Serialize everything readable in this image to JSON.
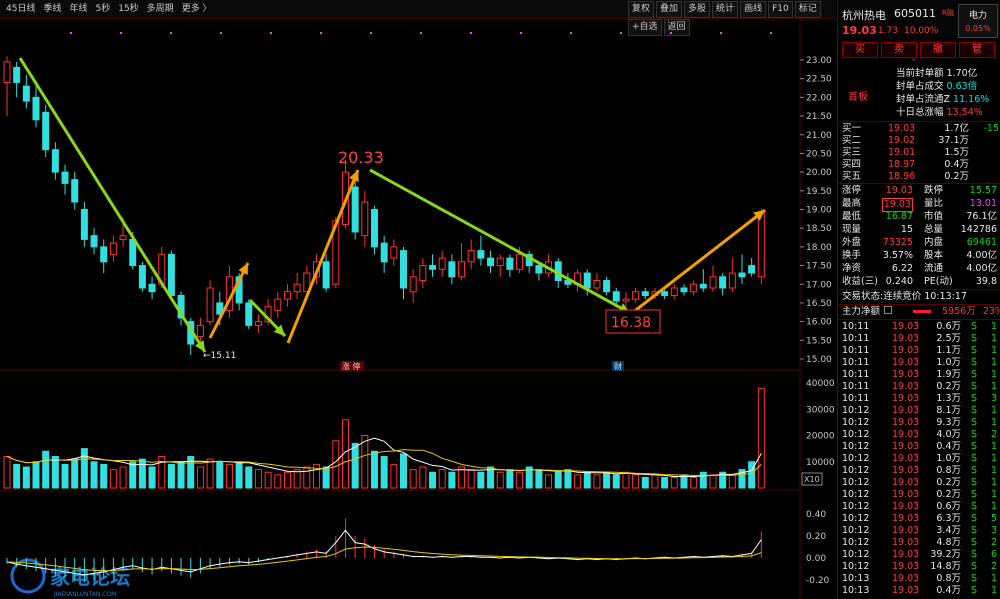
{
  "toolbar": {
    "periods": [
      "45日线",
      "季线",
      "年线",
      "5秒",
      "15秒",
      "多周期",
      "更多 〉"
    ],
    "tools": [
      "复权",
      "叠加",
      "多股",
      "统计",
      "画线",
      "F10",
      "标记",
      "+自选",
      "返回"
    ]
  },
  "chart": {
    "y_ticks": [
      "23.00",
      "22.50",
      "22.00",
      "21.50",
      "21.00",
      "20.50",
      "20.00",
      "19.50",
      "19.00",
      "18.50",
      "18.00",
      "17.50",
      "17.00",
      "16.50",
      "16.00",
      "15.50",
      "15.00"
    ],
    "high_label": "20.33",
    "low_label": "16.38",
    "min_label": "←15.11",
    "event_label_1": "涨 停",
    "event_label_2": "财",
    "vol_ticks": [
      "40000",
      "30000",
      "20000",
      "10000"
    ],
    "vol_unit": "X10",
    "macd_ticks": [
      "0.40",
      "0.20",
      "0.00",
      "-0.20"
    ],
    "watermark": "家电论坛",
    "watermark_sub": "JIADIANLUNTAN.COM"
  },
  "chart_data": {
    "type": "candlestick",
    "ylim": [
      14.8,
      23.3
    ],
    "candles": [
      {
        "o": 22.4,
        "c": 22.95,
        "h": 23.1,
        "l": 21.5
      },
      {
        "o": 22.8,
        "c": 22.4,
        "h": 22.95,
        "l": 22.0
      },
      {
        "o": 22.3,
        "c": 21.9,
        "h": 22.6,
        "l": 21.7
      },
      {
        "o": 22.0,
        "c": 21.4,
        "h": 22.3,
        "l": 21.2
      },
      {
        "o": 21.6,
        "c": 20.6,
        "h": 21.8,
        "l": 20.4
      },
      {
        "o": 20.6,
        "c": 20.0,
        "h": 20.8,
        "l": 19.8
      },
      {
        "o": 20.0,
        "c": 19.7,
        "h": 20.2,
        "l": 19.4
      },
      {
        "o": 19.8,
        "c": 19.2,
        "h": 20.0,
        "l": 19.0
      },
      {
        "o": 19.0,
        "c": 18.2,
        "h": 19.2,
        "l": 18.0
      },
      {
        "o": 18.3,
        "c": 18.0,
        "h": 18.5,
        "l": 17.8
      },
      {
        "o": 18.0,
        "c": 17.6,
        "h": 18.2,
        "l": 17.3
      },
      {
        "o": 17.8,
        "c": 18.1,
        "h": 18.3,
        "l": 17.6
      },
      {
        "o": 18.2,
        "c": 18.3,
        "h": 18.8,
        "l": 18.0
      },
      {
        "o": 18.2,
        "c": 17.5,
        "h": 18.4,
        "l": 17.4
      },
      {
        "o": 17.5,
        "c": 16.9,
        "h": 17.6,
        "l": 16.8
      },
      {
        "o": 17.0,
        "c": 16.8,
        "h": 17.2,
        "l": 16.6
      },
      {
        "o": 17.0,
        "c": 17.8,
        "h": 18.0,
        "l": 16.9
      },
      {
        "o": 17.8,
        "c": 16.7,
        "h": 17.9,
        "l": 16.6
      },
      {
        "o": 16.7,
        "c": 16.1,
        "h": 16.8,
        "l": 15.9
      },
      {
        "o": 16.0,
        "c": 15.4,
        "h": 16.1,
        "l": 15.11
      },
      {
        "o": 15.6,
        "c": 15.9,
        "h": 16.1,
        "l": 15.4
      },
      {
        "o": 16.0,
        "c": 16.9,
        "h": 17.1,
        "l": 15.9
      },
      {
        "o": 16.5,
        "c": 16.2,
        "h": 16.8,
        "l": 15.9
      },
      {
        "o": 16.3,
        "c": 17.2,
        "h": 17.5,
        "l": 16.1
      },
      {
        "o": 17.2,
        "c": 16.5,
        "h": 17.3,
        "l": 16.3
      },
      {
        "o": 16.5,
        "c": 15.9,
        "h": 16.6,
        "l": 15.8
      },
      {
        "o": 15.9,
        "c": 16.0,
        "h": 16.2,
        "l": 15.7
      },
      {
        "o": 16.0,
        "c": 16.4,
        "h": 16.6,
        "l": 15.9
      },
      {
        "o": 16.3,
        "c": 16.6,
        "h": 16.8,
        "l": 16.1
      },
      {
        "o": 16.6,
        "c": 16.8,
        "h": 17.0,
        "l": 16.4
      },
      {
        "o": 16.8,
        "c": 17.0,
        "h": 17.3,
        "l": 16.6
      },
      {
        "o": 16.8,
        "c": 17.3,
        "h": 17.5,
        "l": 16.7
      },
      {
        "o": 17.2,
        "c": 17.6,
        "h": 17.8,
        "l": 17.0
      },
      {
        "o": 17.6,
        "c": 16.9,
        "h": 17.8,
        "l": 16.8
      },
      {
        "o": 17.0,
        "c": 18.7,
        "h": 18.8,
        "l": 16.9
      },
      {
        "o": 18.6,
        "c": 20.0,
        "h": 20.33,
        "l": 18.5
      },
      {
        "o": 19.6,
        "c": 18.4,
        "h": 19.8,
        "l": 18.2
      },
      {
        "o": 18.3,
        "c": 19.2,
        "h": 19.5,
        "l": 18.0
      },
      {
        "o": 19.0,
        "c": 18.0,
        "h": 19.1,
        "l": 17.8
      },
      {
        "o": 18.1,
        "c": 17.6,
        "h": 18.3,
        "l": 17.3
      },
      {
        "o": 17.7,
        "c": 18.0,
        "h": 18.2,
        "l": 17.5
      },
      {
        "o": 17.9,
        "c": 16.9,
        "h": 18.0,
        "l": 16.6
      },
      {
        "o": 16.8,
        "c": 17.2,
        "h": 17.4,
        "l": 16.5
      },
      {
        "o": 17.1,
        "c": 17.5,
        "h": 17.7,
        "l": 16.9
      },
      {
        "o": 17.5,
        "c": 17.4,
        "h": 17.8,
        "l": 17.2
      },
      {
        "o": 17.4,
        "c": 17.7,
        "h": 17.9,
        "l": 17.2
      },
      {
        "o": 17.6,
        "c": 17.2,
        "h": 17.8,
        "l": 17.0
      },
      {
        "o": 17.2,
        "c": 17.6,
        "h": 18.1,
        "l": 17.1
      },
      {
        "o": 17.6,
        "c": 17.9,
        "h": 18.2,
        "l": 17.4
      },
      {
        "o": 17.9,
        "c": 17.7,
        "h": 18.3,
        "l": 17.5
      },
      {
        "o": 17.7,
        "c": 17.5,
        "h": 17.9,
        "l": 17.3
      },
      {
        "o": 17.5,
        "c": 17.7,
        "h": 17.8,
        "l": 17.2
      },
      {
        "o": 17.7,
        "c": 17.4,
        "h": 17.8,
        "l": 17.2
      },
      {
        "o": 17.4,
        "c": 17.8,
        "h": 18.0,
        "l": 17.3
      },
      {
        "o": 17.8,
        "c": 17.5,
        "h": 17.9,
        "l": 17.3
      },
      {
        "o": 17.5,
        "c": 17.3,
        "h": 17.6,
        "l": 17.1
      },
      {
        "o": 17.3,
        "c": 17.6,
        "h": 17.8,
        "l": 17.2
      },
      {
        "o": 17.6,
        "c": 17.1,
        "h": 17.7,
        "l": 16.9
      },
      {
        "o": 17.1,
        "c": 17.0,
        "h": 17.3,
        "l": 16.9
      },
      {
        "o": 17.0,
        "c": 17.3,
        "h": 17.4,
        "l": 16.8
      },
      {
        "o": 17.3,
        "c": 16.9,
        "h": 17.4,
        "l": 16.7
      },
      {
        "o": 16.9,
        "c": 17.1,
        "h": 17.3,
        "l": 16.8
      },
      {
        "o": 17.1,
        "c": 16.8,
        "h": 17.2,
        "l": 16.7
      },
      {
        "o": 16.8,
        "c": 16.55,
        "h": 16.9,
        "l": 16.38
      },
      {
        "o": 16.55,
        "c": 16.6,
        "h": 16.8,
        "l": 16.4
      },
      {
        "o": 16.6,
        "c": 16.8,
        "h": 16.9,
        "l": 16.5
      },
      {
        "o": 16.8,
        "c": 16.7,
        "h": 16.9,
        "l": 16.6
      },
      {
        "o": 16.7,
        "c": 16.8,
        "h": 16.9,
        "l": 16.6
      },
      {
        "o": 16.8,
        "c": 16.7,
        "h": 16.9,
        "l": 16.6
      },
      {
        "o": 16.7,
        "c": 16.9,
        "h": 17.0,
        "l": 16.6
      },
      {
        "o": 16.9,
        "c": 16.8,
        "h": 17.0,
        "l": 16.7
      },
      {
        "o": 16.8,
        "c": 17.0,
        "h": 17.1,
        "l": 16.7
      },
      {
        "o": 17.0,
        "c": 16.9,
        "h": 17.4,
        "l": 16.8
      },
      {
        "o": 16.9,
        "c": 17.2,
        "h": 17.5,
        "l": 16.8
      },
      {
        "o": 17.2,
        "c": 16.9,
        "h": 17.3,
        "l": 16.7
      },
      {
        "o": 16.9,
        "c": 17.3,
        "h": 17.7,
        "l": 16.8
      },
      {
        "o": 17.3,
        "c": 17.2,
        "h": 17.8,
        "l": 17.0
      },
      {
        "o": 17.5,
        "c": 17.3,
        "h": 17.7,
        "l": 17.2
      },
      {
        "o": 17.2,
        "c": 18.9,
        "h": 19.03,
        "l": 17.0
      }
    ],
    "volume": [
      12,
      9,
      8,
      10,
      14,
      12,
      9,
      11,
      15,
      10,
      9,
      7,
      8,
      10,
      11,
      8,
      12,
      9,
      10,
      12,
      8,
      11,
      10,
      9,
      10,
      8,
      7,
      6,
      5,
      6,
      7,
      8,
      9,
      8,
      18,
      26,
      17,
      20,
      14,
      12,
      9,
      13,
      7,
      8,
      6,
      7,
      6,
      8,
      7,
      6,
      8,
      6,
      7,
      6,
      8,
      7,
      5,
      6,
      7,
      5,
      6,
      5,
      6,
      5,
      6,
      5,
      4,
      5,
      4,
      4,
      5,
      4,
      6,
      5,
      6,
      5,
      7,
      10,
      38
    ],
    "macd": [
      -0.05,
      -0.08,
      -0.1,
      -0.12,
      -0.14,
      -0.16,
      -0.18,
      -0.2,
      -0.22,
      -0.2,
      -0.18,
      -0.15,
      -0.12,
      -0.1,
      -0.13,
      -0.15,
      -0.12,
      -0.14,
      -0.16,
      -0.18,
      -0.14,
      -0.1,
      -0.08,
      -0.06,
      -0.05,
      -0.06,
      -0.04,
      -0.02,
      0.0,
      0.02,
      0.04,
      0.06,
      0.08,
      0.06,
      0.2,
      0.36,
      0.2,
      0.18,
      0.12,
      0.08,
      0.06,
      0.04,
      0.02,
      0.02,
      0.01,
      0.02,
      0.01,
      0.02,
      0.02,
      0.01,
      0.01,
      0.0,
      0.01,
      0.0,
      0.01,
      0.0,
      -0.01,
      0.0,
      -0.01,
      -0.02,
      -0.01,
      -0.02,
      -0.01,
      -0.02,
      -0.01,
      0.0,
      -0.01,
      0.0,
      0.01,
      0.0,
      0.01,
      0.02,
      0.01,
      0.02,
      0.03,
      0.02,
      0.04,
      0.06,
      0.24
    ]
  },
  "stock": {
    "name": "杭州热电",
    "code": "605011",
    "tag": "R融",
    "sector": "电力",
    "sector_pct": "0.05%",
    "price": "19.03",
    "change": "1.73",
    "pct": "10.00%"
  },
  "trade_buttons": [
    "买",
    "卖",
    "撤",
    "管"
  ],
  "board": {
    "label": "首板",
    "seal_label": "当前封单额",
    "seal_value": "1.70亿",
    "seal_ratio_label": "封单占成交",
    "seal_ratio_value": "0.63倍",
    "float_label": "封单占流通Z",
    "float_value": "11.16%",
    "ten_day_label": "十日总涨幅",
    "ten_day_value": "13.54%"
  },
  "orderbook": [
    {
      "label": "买一",
      "price": "19.03",
      "vol": "1.7亿",
      "chg": "-15"
    },
    {
      "label": "买二",
      "price": "19.02",
      "vol": "37.1万",
      "chg": ""
    },
    {
      "label": "买三",
      "price": "19.01",
      "vol": "1.5万",
      "chg": ""
    },
    {
      "label": "买四",
      "price": "18.97",
      "vol": "0.4万",
      "chg": ""
    },
    {
      "label": "买五",
      "price": "18.96",
      "vol": "0.2万",
      "chg": ""
    }
  ],
  "quote": [
    {
      "l1": "涨停",
      "v1": "19.03",
      "l2": "跌停",
      "v2": "15.57"
    },
    {
      "l1": "最高",
      "v1": "19.03",
      "l2": "量比",
      "v2": "13.01"
    },
    {
      "l1": "最低",
      "v1": "16.87",
      "l2": "市值",
      "v2": "76.1亿"
    },
    {
      "l1": "现量",
      "v1": "15",
      "l2": "总量",
      "v2": "142786"
    },
    {
      "l1": "外盘",
      "v1": "73325",
      "l2": "内盘",
      "v2": "69461"
    },
    {
      "l1": "换手",
      "v1": "3.57%",
      "l2": "股本",
      "v2": "4.00亿"
    },
    {
      "l1": "净资",
      "v1": "6.22",
      "l2": "流通",
      "v2": "4.00亿"
    },
    {
      "l1": "收益(三)",
      "v1": "0.240",
      "l2": "PE(动)",
      "v2": "39.8"
    }
  ],
  "status": {
    "label": "交易状态:",
    "value": "连续竞价",
    "time": "10:13:17"
  },
  "mainflow": {
    "label": "主力净额",
    "value": "5956万",
    "pct": "23%"
  },
  "ticks": [
    {
      "t": "10:11",
      "p": "19.03",
      "v": "0.6万",
      "s": "S",
      "n": "1"
    },
    {
      "t": "10:11",
      "p": "19.03",
      "v": "2.5万",
      "s": "S",
      "n": "1"
    },
    {
      "t": "10:11",
      "p": "19.03",
      "v": "1.1万",
      "s": "S",
      "n": "1"
    },
    {
      "t": "10:11",
      "p": "19.03",
      "v": "1.0万",
      "s": "S",
      "n": "1"
    },
    {
      "t": "10:11",
      "p": "19.03",
      "v": "1.9万",
      "s": "S",
      "n": "1"
    },
    {
      "t": "10:11",
      "p": "19.03",
      "v": "0.2万",
      "s": "S",
      "n": "1"
    },
    {
      "t": "10:11",
      "p": "19.03",
      "v": "1.3万",
      "s": "S",
      "n": "3"
    },
    {
      "t": "10:12",
      "p": "19.03",
      "v": "8.1万",
      "s": "S",
      "n": "1"
    },
    {
      "t": "10:12",
      "p": "19.03",
      "v": "9.3万",
      "s": "S",
      "n": "1"
    },
    {
      "t": "10:12",
      "p": "19.03",
      "v": "4.0万",
      "s": "S",
      "n": "2"
    },
    {
      "t": "10:12",
      "p": "19.03",
      "v": "0.4万",
      "s": "S",
      "n": "1"
    },
    {
      "t": "10:12",
      "p": "19.03",
      "v": "1.0万",
      "s": "S",
      "n": "1"
    },
    {
      "t": "10:12",
      "p": "19.03",
      "v": "0.8万",
      "s": "S",
      "n": "1"
    },
    {
      "t": "10:12",
      "p": "19.03",
      "v": "0.2万",
      "s": "S",
      "n": "1"
    },
    {
      "t": "10:12",
      "p": "19.03",
      "v": "0.2万",
      "s": "S",
      "n": "1"
    },
    {
      "t": "10:12",
      "p": "19.03",
      "v": "0.6万",
      "s": "S",
      "n": "1"
    },
    {
      "t": "10:12",
      "p": "19.03",
      "v": "6.3万",
      "s": "S",
      "n": "5"
    },
    {
      "t": "10:12",
      "p": "19.03",
      "v": "3.4万",
      "s": "S",
      "n": "3"
    },
    {
      "t": "10:12",
      "p": "19.03",
      "v": "4.8万",
      "s": "S",
      "n": "2"
    },
    {
      "t": "10:12",
      "p": "19.03",
      "v": "39.2万",
      "s": "S",
      "n": "6"
    },
    {
      "t": "10:12",
      "p": "19.03",
      "v": "14.8万",
      "s": "S",
      "n": "2"
    },
    {
      "t": "10:13",
      "p": "19.03",
      "v": "0.8万",
      "s": "S",
      "n": "1"
    },
    {
      "t": "10:13",
      "p": "19.03",
      "v": "0.4万",
      "s": "S",
      "n": "1"
    }
  ]
}
